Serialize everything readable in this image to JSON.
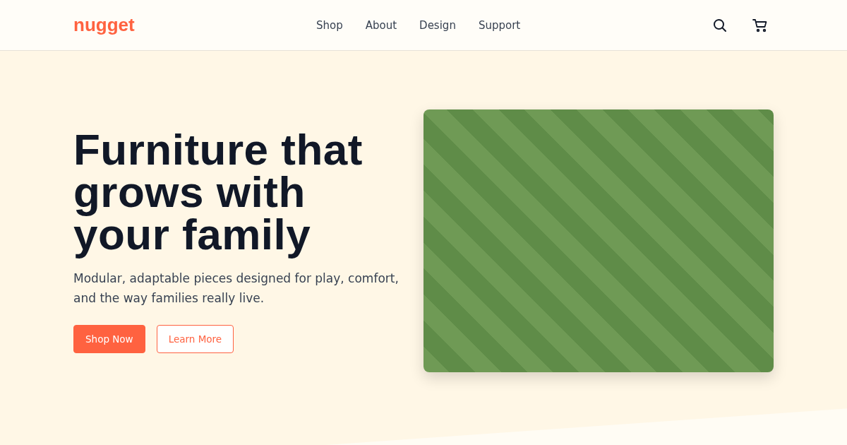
{
  "header": {
    "logo": "nugget",
    "nav": [
      {
        "label": "Shop"
      },
      {
        "label": "About"
      },
      {
        "label": "Design"
      },
      {
        "label": "Support"
      }
    ]
  },
  "hero": {
    "title": "Furniture that grows with your family",
    "subtitle": "Modular, adaptable pieces designed for play, comfort, and the way families really live.",
    "buttons": [
      {
        "label": "Shop Now",
        "kind": "primary"
      },
      {
        "label": "Learn More",
        "kind": "secondary"
      }
    ]
  }
}
